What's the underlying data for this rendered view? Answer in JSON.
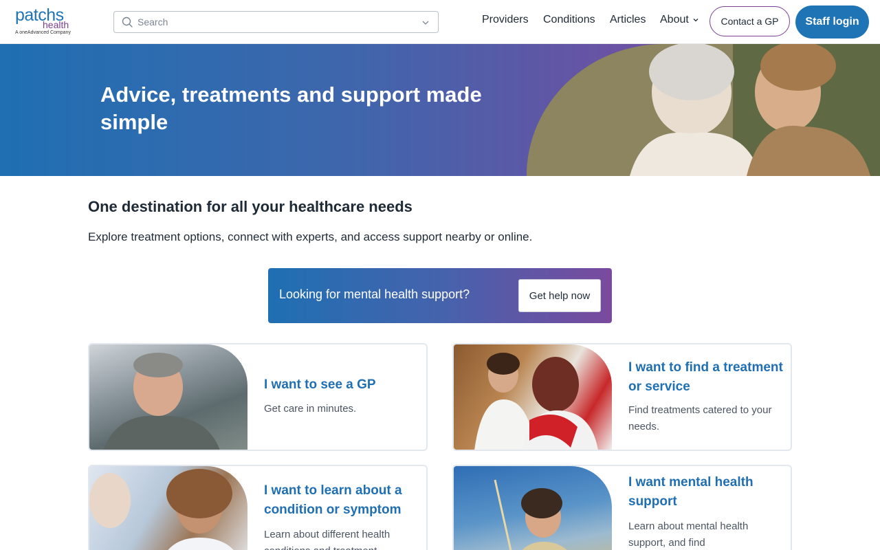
{
  "header": {
    "logo": {
      "main": "patchs",
      "sub": "health",
      "company": "A oneAdvanced Company"
    },
    "search": {
      "placeholder": "Search"
    },
    "nav": [
      {
        "label": "Providers"
      },
      {
        "label": "Conditions"
      },
      {
        "label": "Articles"
      },
      {
        "label": "About"
      }
    ],
    "contact_label": "Contact a GP",
    "staff_label": "Staff login"
  },
  "hero": {
    "title": "Advice, treatments and support made simple"
  },
  "intro": {
    "title": "One destination for all your healthcare needs",
    "text": "Explore treatment options, connect with experts, and access support nearby or online."
  },
  "banner": {
    "text": "Looking for mental health support?",
    "button_label": "Get help now"
  },
  "cards": [
    {
      "title": "I want to see a GP",
      "desc": "Get care in minutes."
    },
    {
      "title": "I want to find a treatment or service",
      "desc": "Find treatments catered to your needs."
    },
    {
      "title": "I want to learn about a condition or symptom",
      "desc": "Learn about different health conditions and treatment"
    },
    {
      "title": "I want mental health support",
      "desc": "Learn about mental health support, and find"
    }
  ],
  "colors": {
    "primary": "#1f74b6",
    "accent": "#7a3e93"
  }
}
